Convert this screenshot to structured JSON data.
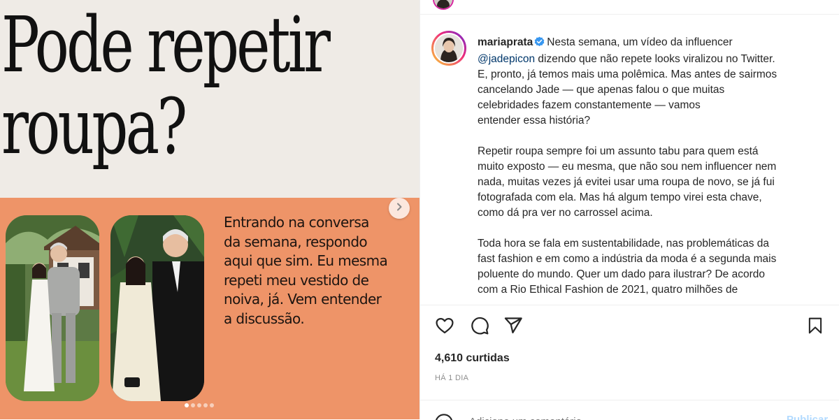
{
  "carousel": {
    "headline_line1": "Pode repetir",
    "headline_line2": "roupa?",
    "body_text": "Entrando na conversa\nda semana, respondo\naqui que sim. Eu mesma\nrepeti meu vestido de\nnoiva, já. Vem entender\na discussão.",
    "slide_count": 5,
    "active_slide": 1,
    "colors": {
      "top_background": "#efebe6",
      "bottom_background": "#ee9468"
    }
  },
  "post": {
    "username": "mariaprata",
    "verified": true,
    "caption": {
      "p1_before_mention": "Nesta semana, um vídeo da influencer",
      "mention": "@jadepicon",
      "p1_after_mention": "dizendo que não repete looks viralizou no Twitter.\nE, pronto, já temos mais uma polêmica. Mas antes de sairmos\ncancelando Jade — que apenas falou o que muitas\ncelebridades fazem constantemente — vamos\nentender essa história?",
      "p2": "Repetir roupa sempre foi um assunto tabu para quem está\nmuito exposto — eu mesma, que não sou nem influencer nem\nnada, muitas vezes já evitei usar uma roupa de novo, se já fui\nfotografada com ela. Mas há algum tempo virei esta chave,\ncomo dá pra ver no carrossel acima.",
      "p3": "Toda hora se fala em sustentabilidade, nas problemáticas da\nfast fashion e em como a indústria da moda é a segunda mais\npoluente do mundo. Quer um dado para ilustrar? De acordo\ncom a Rio Ethical Fashion de 2021, quatro milhões de"
    },
    "icons": {
      "like": "heart-icon",
      "comment": "comment-icon",
      "share": "send-icon",
      "save": "bookmark-icon",
      "emoji": "emoji-icon",
      "next": "chevron-right-icon",
      "verified": "verified-badge-icon"
    },
    "likes_label": "4,610 curtidas",
    "time_label": "HÁ 1 DIA",
    "comment_placeholder": "Adicione um comentário...",
    "publish_label": "Publicar",
    "colors": {
      "link": "#00376b",
      "verified": "#3897f0",
      "publish": "#b3dbff",
      "muted": "#8e8e8e"
    }
  }
}
